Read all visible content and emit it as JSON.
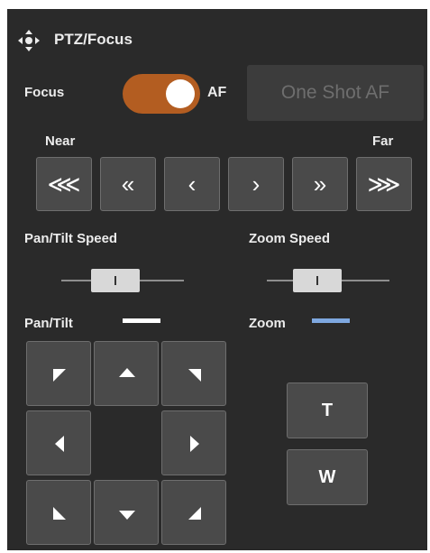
{
  "header": {
    "title": "PTZ/Focus",
    "icon": "move-arrows-icon"
  },
  "focus": {
    "label": "Focus",
    "mode_label": "AF",
    "toggle_on": true,
    "toggle_color": "#b35d21",
    "one_shot_label": "One Shot AF",
    "near_label": "Near",
    "far_label": "Far",
    "buttons": [
      "⋘",
      "«",
      "‹",
      "›",
      "»",
      "⋙"
    ]
  },
  "speed": {
    "pan_tilt_label": "Pan/Tilt Speed",
    "pan_tilt_value": 0.4,
    "zoom_label": "Zoom Speed",
    "zoom_value": 0.35
  },
  "pan_tilt": {
    "label": "Pan/Tilt",
    "indicator_color": "#ffffff",
    "buttons": [
      "up-left",
      "up",
      "up-right",
      "left",
      "right",
      "down-left",
      "down",
      "down-right"
    ]
  },
  "zoom": {
    "label": "Zoom",
    "indicator_color": "#7ea8e0",
    "tele_label": "T",
    "wide_label": "W"
  }
}
